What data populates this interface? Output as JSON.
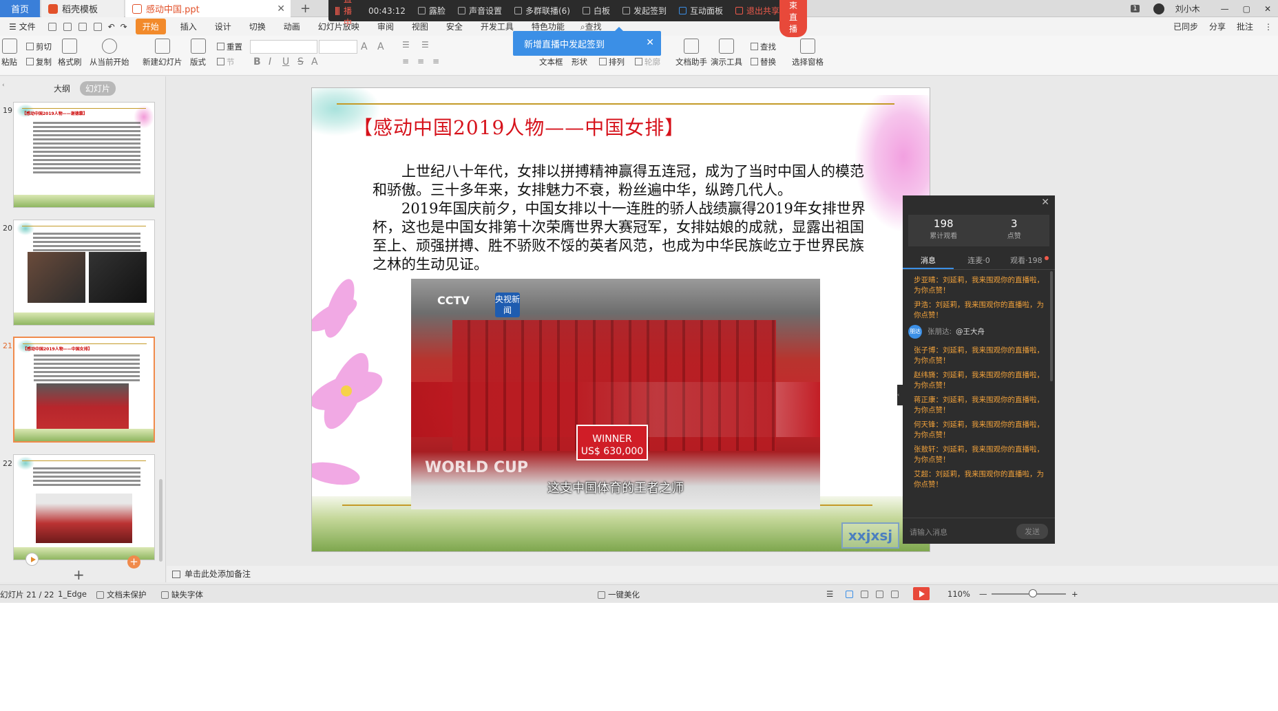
{
  "titlebar": {
    "tabs": [
      {
        "label": "首页"
      },
      {
        "label": "稻壳模板"
      },
      {
        "label": "感动中国.ppt"
      }
    ],
    "page_badge": "1",
    "user_name": "刘小木"
  },
  "livebar": {
    "status": "直播中",
    "timer": "00:43:12",
    "items": [
      "露脸",
      "声音设置",
      "多群联播(6)",
      "白板",
      "发起签到",
      "互动面板"
    ],
    "exit_label": "退出共享",
    "end_label": "结束直播"
  },
  "menu": {
    "file": "文件",
    "items": [
      "开始",
      "插入",
      "设计",
      "切换",
      "动画",
      "幻灯片放映",
      "审阅",
      "视图",
      "安全",
      "开发工具",
      "特色功能"
    ],
    "search": "查找",
    "right": [
      "已同步",
      "分享",
      "批注"
    ]
  },
  "ribbon": {
    "paste": "粘贴",
    "cut": "剪切",
    "copy": "复制",
    "format_painter": "格式刷",
    "from_current": "从当前开始",
    "new_slide": "新建幻灯片",
    "layout": "版式",
    "reset": "重置",
    "section": "节",
    "textbox": "文本框",
    "shape": "形状",
    "arrange": "排列",
    "outline": "轮廓",
    "doc_helper": "文档助手",
    "present_tools": "演示工具",
    "find": "查找",
    "replace": "替换",
    "select_pane": "选择窗格"
  },
  "toast": {
    "text": "新增直播中发起签到"
  },
  "panel": {
    "tab_outline": "大纲",
    "tab_slides": "幻灯片",
    "slides": [
      {
        "num": "19",
        "title": "【感动中国2019人物——谢德霖】"
      },
      {
        "num": "20"
      },
      {
        "num": "21",
        "title": "【感动中国2019人物——中国女排】"
      },
      {
        "num": "22"
      }
    ]
  },
  "slide": {
    "title": "【感动中国2019人物——中国女排】",
    "para1": "上世纪八十年代，女排以拼搏精神赢得五连冠，成为了当时中国人的模范和骄傲。三十多年来，女排魅力不衰，粉丝遍中华，纵跨几代人。",
    "para2": "2019年国庆前夕，中国女排以十一连胜的骄人战绩赢得2019年女排世界杯，这也是中国女排第十次荣膺世界大赛冠军，女排姑娘的成就，显露出祖国至上、顽强拼搏、胜不骄败不馁的英者风范，也成为中华民族屹立于世界民族之林的生动见证。",
    "photo": {
      "logo": "CCTV",
      "news": "央视新闻",
      "check_line1": "WINNER",
      "check_line2": "US$ 630,000",
      "caption": "这支中国体育的王者之师",
      "bottom_text": "WORLD CUP"
    },
    "watermark": "xxjxsj"
  },
  "chat": {
    "total_views": "198",
    "total_views_label": "累计观看",
    "likes": "3",
    "likes_label": "点赞",
    "tabs": [
      "消息",
      "连麦·0",
      "观看·198"
    ],
    "messages": [
      "步亚晴：刘延莉，我来围观你的直播啦，为你点赞！",
      "尹浩：刘延莉，我来围观你的直播啦，为你点赞！",
      "张子博：刘延莉，我来围观你的直播啦，为你点赞！",
      "赵纬旖：刘延莉，我来围观你的直播啦，为你点赞！",
      "蒋正康：刘延莉，我来围观你的直播啦，为你点赞！",
      "何天锋：刘延莉，我来围观你的直播啦，为你点赞！",
      "张敖轩：刘延莉，我来围观你的直播啦，为你点赞！",
      "艾超：刘延莉，我来围观你的直播啦，为你点赞！"
    ],
    "system_msg": {
      "tag": "朋达",
      "from": "张朋达:",
      "at": "@王大舟"
    },
    "input_placeholder": "请输入消息",
    "send": "发送"
  },
  "notes": {
    "placeholder": "单击此处添加备注"
  },
  "status": {
    "slide_counter": "幻灯片 21 / 22",
    "theme": "1_Edge",
    "protect": "文档未保护",
    "missing_font": "缺失字体",
    "beautify": "一键美化",
    "zoom": "110%"
  }
}
